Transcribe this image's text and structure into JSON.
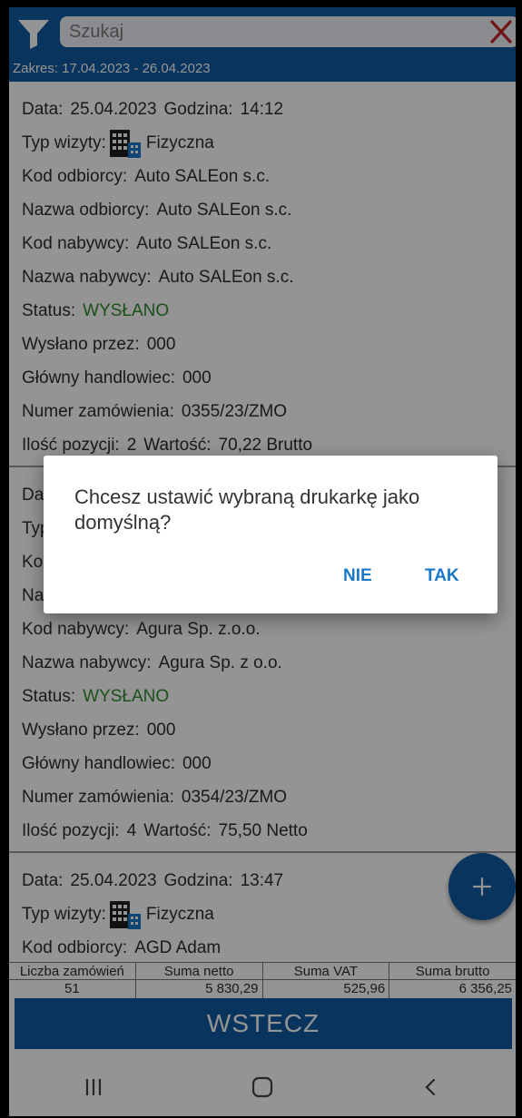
{
  "search": {
    "placeholder": "Szukaj"
  },
  "range": "Zakres: 17.04.2023 - 26.04.2023",
  "labels": {
    "date": "Data:",
    "hour": "Godzina:",
    "visit_type": "Typ wizyty:",
    "recipient_code": "Kod odbiorcy:",
    "recipient_name": "Nazwa odbiorcy:",
    "buyer_code": "Kod nabywcy:",
    "buyer_name": "Nazwa nabywcy:",
    "status": "Status:",
    "sent_by": "Wysłano przez:",
    "main_rep": "Główny handlowiec:",
    "order_number": "Numer zamówienia:",
    "item_count": "Ilość pozycji:",
    "value": "Wartość:"
  },
  "orders": [
    {
      "date": "25.04.2023",
      "hour": "14:12",
      "visit_type": "Fizyczna",
      "recipient_code": "Auto SALEon s.c.",
      "recipient_name": "Auto SALEon s.c.",
      "buyer_code": "Auto SALEon s.c.",
      "buyer_name": "Auto SALEon s.c.",
      "status": "WYSŁANO",
      "sent_by": "000",
      "main_rep": "000",
      "order_number": "0355/23/ZMO",
      "item_count": "2",
      "value": "70,22 Brutto"
    },
    {
      "date_partial": "Da",
      "visit_partial": "Typ",
      "code_partial": "Ko",
      "name_partial": "Na",
      "buyer_code": "Agura Sp. z.o.o.",
      "buyer_name": "Agura Sp. z o.o.",
      "status": "WYSŁANO",
      "sent_by": "000",
      "main_rep": "000",
      "order_number": "0354/23/ZMO",
      "item_count": "4",
      "value": "75,50 Netto"
    },
    {
      "date": "25.04.2023",
      "hour": "13:47",
      "visit_type": "Fizyczna",
      "recipient_code": "AGD Adam"
    }
  ],
  "summary": {
    "headers": [
      "Liczba zamówień",
      "Suma netto",
      "Suma VAT",
      "Suma brutto"
    ],
    "values": [
      "51",
      "5 830,29",
      "525,96",
      "6 356,25"
    ]
  },
  "back_label": "WSTECZ",
  "dialog": {
    "message": "Chcesz ustawić wybraną drukarkę jako domyślną?",
    "no": "NIE",
    "yes": "TAK"
  },
  "colors": {
    "primary": "#0e5aa3",
    "status_ok": "#2e8b2e",
    "dialog_button": "#1a78c8"
  },
  "icons": [
    "filter-icon",
    "clear-icon",
    "building-icon",
    "plus-icon",
    "recent-apps-icon",
    "home-icon",
    "back-nav-icon"
  ]
}
